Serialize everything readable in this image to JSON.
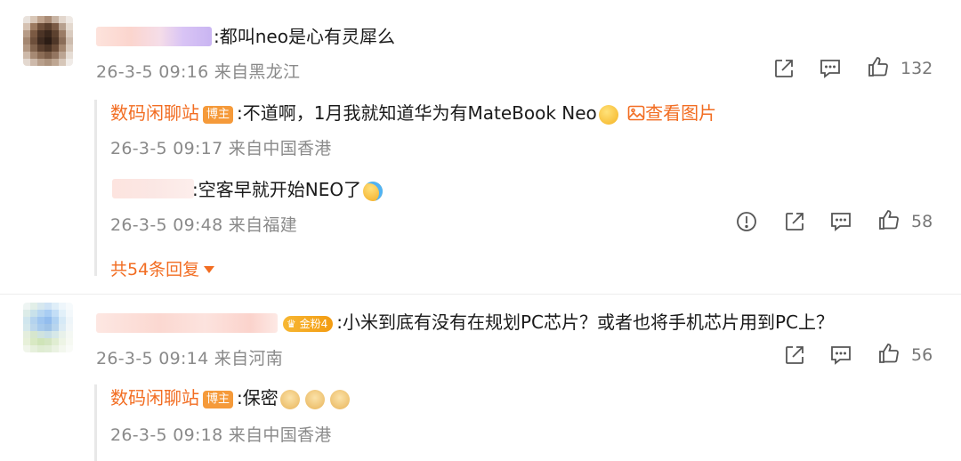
{
  "comments": [
    {
      "text": ":都叫neo是心有灵犀么",
      "time": "26-3-5 09:16 来自黑龙江",
      "likes": "132"
    },
    {
      "text": ":小米到底有没有在规划PC芯片？或者也将手机芯片用到PC上？",
      "badge": "金粉4",
      "time": "26-3-5 09:14 来自河南",
      "likes": "56"
    }
  ],
  "replies": [
    {
      "author": "数码闲聊站",
      "badge": "博主",
      "text": ":不道啊，1月我就知道华为有MateBook Neo",
      "image_link": "查看图片",
      "time": "26-3-5 09:17 来自中国香港"
    },
    {
      "text": ":空客早就开始NEO了",
      "time": "26-3-5 09:48 来自福建",
      "likes": "58"
    },
    {
      "author": "数码闲聊站",
      "badge": "博主",
      "text": ":保密",
      "time": "26-3-5 09:18 来自中国香港"
    }
  ],
  "expand_label": "共54条回复",
  "icons": {
    "share": "share-icon",
    "comment": "comment-icon",
    "like": "thumbs-up-icon",
    "report": "report-icon",
    "image": "image-icon"
  },
  "colors": {
    "accent": "#f26d22",
    "meta": "#8a8a8a",
    "badge": "#f59a3a"
  }
}
